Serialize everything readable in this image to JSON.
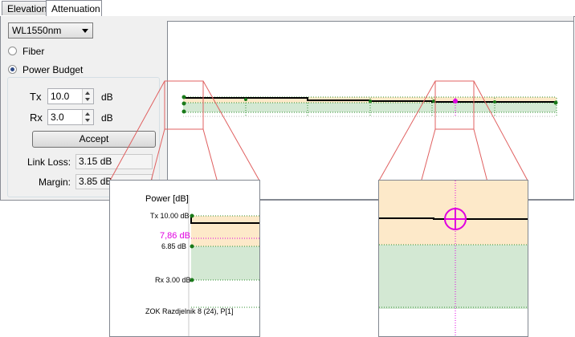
{
  "tabs": [
    {
      "label": "Elevation",
      "active": false
    },
    {
      "label": "Attenuation",
      "active": true
    }
  ],
  "wavelength": {
    "selected": "WL1550nm"
  },
  "mode": {
    "fiber_label": "Fiber",
    "power_budget_label": "Power Budget",
    "selected": "Power Budget"
  },
  "power_budget": {
    "tx_label": "Tx",
    "tx_value": "10.0",
    "tx_unit": "dB",
    "rx_label": "Rx",
    "rx_value": "3.0",
    "rx_unit": "dB",
    "accept_label": "Accept",
    "link_loss_label": "Link Loss:",
    "link_loss_value": "3.15 dB",
    "margin_label": "Margin:",
    "margin_value": "3.85 dB"
  },
  "zoom_left": {
    "axis_title": "Power [dB]",
    "tx_label": "Tx 10.00 dB",
    "marker_label": "7,86 dB",
    "level_label": "6.85 dB",
    "rx_label": "Rx 3.00 dB",
    "bottom_label": "ZOK Razdjelnik 8 (24), P[1]"
  },
  "colors": {
    "budget_fill": "#fde9c9",
    "margin_fill": "#d3e8d3",
    "marker": "#e000e0",
    "trace": "#000000",
    "point": "#1a7a1a",
    "zoom_line": "#e06060",
    "dotted": "#2f8f2f"
  }
}
